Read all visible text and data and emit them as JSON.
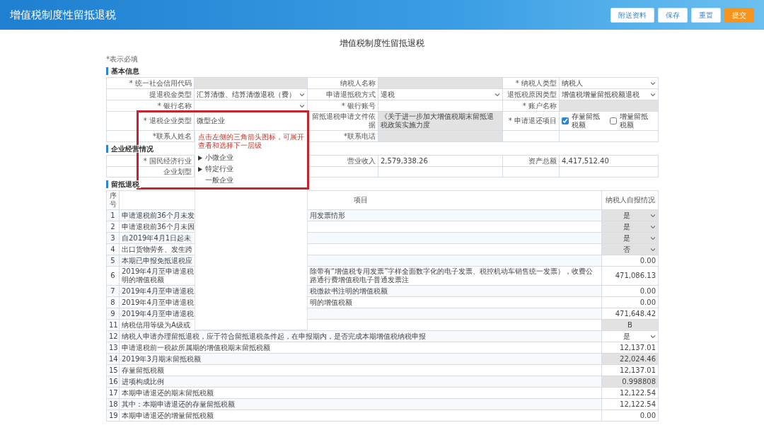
{
  "header": {
    "title": "增值税制度性留抵退税",
    "buttons": [
      {
        "label": "附送资料",
        "kind": "default"
      },
      {
        "label": "保存",
        "kind": "default"
      },
      {
        "label": "重置",
        "kind": "default"
      },
      {
        "label": "提交",
        "kind": "primary"
      }
    ]
  },
  "page_title": "增值税制度性留抵退税",
  "required_note": "*表示必填",
  "basic_info": {
    "heading": "基本信息",
    "rows": [
      [
        {
          "label": "* 统一社会信用代码",
          "field": {
            "kind": "input",
            "readonly": true
          }
        },
        {
          "label": "纳税人名称",
          "field": {
            "kind": "input",
            "readonly": true
          }
        },
        {
          "label": "* 纳税人类型",
          "field": {
            "kind": "select",
            "value": "纳税人",
            "readonly": false
          }
        }
      ],
      [
        {
          "label": "提退税金类型",
          "field": {
            "kind": "select",
            "value": "汇算清缴、结算清缴退税（费）",
            "readonly": false
          }
        },
        {
          "label": "申请退抵税方式",
          "field": {
            "kind": "select",
            "value": "退税",
            "readonly": false
          }
        },
        {
          "label": "退抵税原因类型",
          "field": {
            "kind": "select",
            "value": "增值税增量留抵税额退税",
            "readonly": false
          }
        }
      ],
      [
        {
          "label": "* 银行名称",
          "field": {
            "kind": "select",
            "readonly": false
          }
        },
        {
          "label": "* 银行账号",
          "field": {
            "kind": "input",
            "readonly": false
          }
        },
        {
          "label": "* 账户名称",
          "field": {
            "kind": "input",
            "readonly": true
          }
        }
      ],
      [
        {
          "label": "* 退税企业类型",
          "field": {
            "kind": "input",
            "value": "微型企业",
            "readonly": false,
            "dropdown": {
              "hint": "点击左侧的三角箭头图标，可展开查看和选择下一层级",
              "items": [
                {
                  "label": "小微企业",
                  "expandable": true
                },
                {
                  "label": "特定行业",
                  "expandable": true
                },
                {
                  "label": "一般企业",
                  "expandable": false
                }
              ]
            }
          }
        },
        {
          "label": "留抵退税申请文件依据",
          "field": {
            "kind": "input",
            "value": "《关于进一步加大增值税期末留抵退税政策实施力度",
            "readonly": true
          }
        },
        {
          "label": "* 申请退还项目",
          "field": {
            "kind": "checks",
            "options": [
              {
                "label": "存量留抵税额",
                "checked": true
              },
              {
                "label": "增量留抵税额",
                "checked": false
              }
            ]
          }
        }
      ],
      [
        {
          "label": "*联系人姓名"
        },
        {
          "label": "*联系电话",
          "field": {
            "kind": "input",
            "readonly": true
          }
        }
      ]
    ]
  },
  "operations": {
    "heading": "企业经营情况",
    "rows": [
      [
        {
          "label": "* 国民经济行业"
        },
        {
          "label": "营业收入",
          "field": {
            "kind": "input",
            "value": "2,579,338.26",
            "readonly": false
          }
        },
        {
          "label": "资产总额",
          "field": {
            "kind": "input",
            "value": "4,417,512.40",
            "readonly": false
          }
        }
      ],
      [
        {
          "label": "企业划型"
        }
      ]
    ]
  },
  "refund": {
    "heading": "留抵退税",
    "columns": [
      "序号",
      "项目",
      "纳税人自报情况"
    ],
    "rows": [
      {
        "no": "1",
        "item_left": [
          "申请退税前36个月未发"
        ],
        "item_right": "用发票情形",
        "value": {
          "kind": "select",
          "value": "是",
          "readonly": true
        }
      },
      {
        "no": "2",
        "item_left": [
          "申请退税前36个月未因"
        ],
        "value": {
          "kind": "select",
          "value": "是",
          "readonly": true
        }
      },
      {
        "no": "3",
        "item_left": [
          "自2019年4月1日起未"
        ],
        "value": {
          "kind": "select",
          "value": "是",
          "readonly": true
        }
      },
      {
        "no": "4",
        "item_left": [
          "出口货物劳务、发生跨"
        ],
        "value": {
          "kind": "select",
          "value": "否",
          "readonly": true
        }
      },
      {
        "no": "5",
        "item_left": [
          "本期已申报免抵退税应"
        ],
        "value": {
          "kind": "number",
          "value": "0.00",
          "readonly": false
        }
      },
      {
        "no": "6",
        "item_left": [
          "2019年4月至申请退税",
          "明的增值税额"
        ],
        "item_right": "除带有“增值税专用发票”字样全面数字化的电子发票、税控机动车销售统一发票），收费公路通行费增值税电子普通发票注",
        "value": {
          "kind": "number",
          "value": "471,086.13",
          "readonly": false
        }
      },
      {
        "no": "7",
        "item_left": [
          "2019年4月至申请退税"
        ],
        "item_right": "税缴款书注明的增值税额",
        "value": {
          "kind": "number",
          "value": "0.00",
          "readonly": false
        }
      },
      {
        "no": "8",
        "item_left": [
          "2019年4月至申请退税"
        ],
        "item_right": "明的增值税额",
        "value": {
          "kind": "number",
          "value": "0.00",
          "readonly": false
        }
      },
      {
        "no": "9",
        "item_left": [
          "2019年4月至申请退税"
        ],
        "value": {
          "kind": "number",
          "value": "471,648.42",
          "readonly": false
        }
      },
      {
        "no": "11",
        "item_left": [
          "纳税信用等级为A级或"
        ],
        "value": {
          "kind": "text",
          "value": "B",
          "readonly": true
        }
      },
      {
        "no": "12",
        "item": "纳税人申请办理留抵退税，应于符合留抵退税条件起，在申报期内，是否完成本期增值税纳税申报",
        "value": {
          "kind": "select",
          "value": "是",
          "readonly": false
        }
      },
      {
        "no": "13",
        "item": "申请退税前一税款所属期的增值税期末留抵税额",
        "value": {
          "kind": "number",
          "value": "12,137.01",
          "readonly": false
        }
      },
      {
        "no": "14",
        "item": "2019年3月期末留抵税额",
        "value": {
          "kind": "number",
          "value": "22,024.46",
          "readonly": true
        }
      },
      {
        "no": "15",
        "item": "存量留抵税额",
        "value": {
          "kind": "number",
          "value": "12,137.01",
          "readonly": false
        }
      },
      {
        "no": "16",
        "item": "进项构成比例",
        "value": {
          "kind": "number",
          "value": "0.998808",
          "readonly": true
        }
      },
      {
        "no": "17",
        "item": "本期申请退还的期末留抵税额",
        "value": {
          "kind": "number",
          "value": "12,122.54",
          "readonly": false
        }
      },
      {
        "no": "18",
        "item": "其中：本期申请退还的存量留抵税额",
        "value": {
          "kind": "number",
          "value": "12,122.54",
          "readonly": false
        }
      },
      {
        "no": "19",
        "item": "本期申请退还的增量留抵税额",
        "value": {
          "kind": "number",
          "value": "0.00",
          "readonly": false
        }
      }
    ]
  }
}
